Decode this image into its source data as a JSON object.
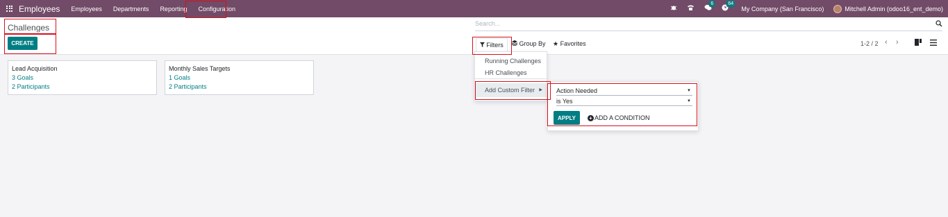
{
  "navbar": {
    "brand": "Employees",
    "menu": [
      "Employees",
      "Departments",
      "Reporting",
      "Configuration"
    ],
    "chat_badge": "6",
    "activity_badge": "64",
    "company": "My Company (San Francisco)",
    "user": "Mitchell Admin (odoo16_ent_demo)",
    "brand_color": "#714b67"
  },
  "control": {
    "title": "Challenges",
    "create_label": "CREATE",
    "search_placeholder": "Search...",
    "filters_label": "Filters",
    "groupby_label": "Group By",
    "favorites_label": "Favorites",
    "pager": "1-2 / 2",
    "accent_color": "#017e84"
  },
  "cards": [
    {
      "title": "Lead Acquisition",
      "goals": "3 Goals",
      "participants": "2 Participants"
    },
    {
      "title": "Monthly Sales Targets",
      "goals": "1 Goals",
      "participants": "2 Participants"
    }
  ],
  "filter_dropdown": {
    "items": [
      "Running Challenges",
      "HR Challenges"
    ],
    "custom_filter_label": "Add Custom Filter"
  },
  "custom_filter": {
    "field": "Action Needed",
    "operator": "is Yes",
    "apply_label": "APPLY",
    "add_condition_label": "ADD A CONDITION"
  },
  "icons": [
    "apps-icon",
    "bug-icon",
    "phone-icon",
    "chat-icon",
    "clock-icon",
    "search-icon",
    "filter-icon",
    "layers-icon",
    "star-icon",
    "chevron-left-icon",
    "chevron-right-icon",
    "kanban-view-icon",
    "list-view-icon",
    "caret-right-icon",
    "caret-down-icon",
    "plus-circle-icon"
  ]
}
